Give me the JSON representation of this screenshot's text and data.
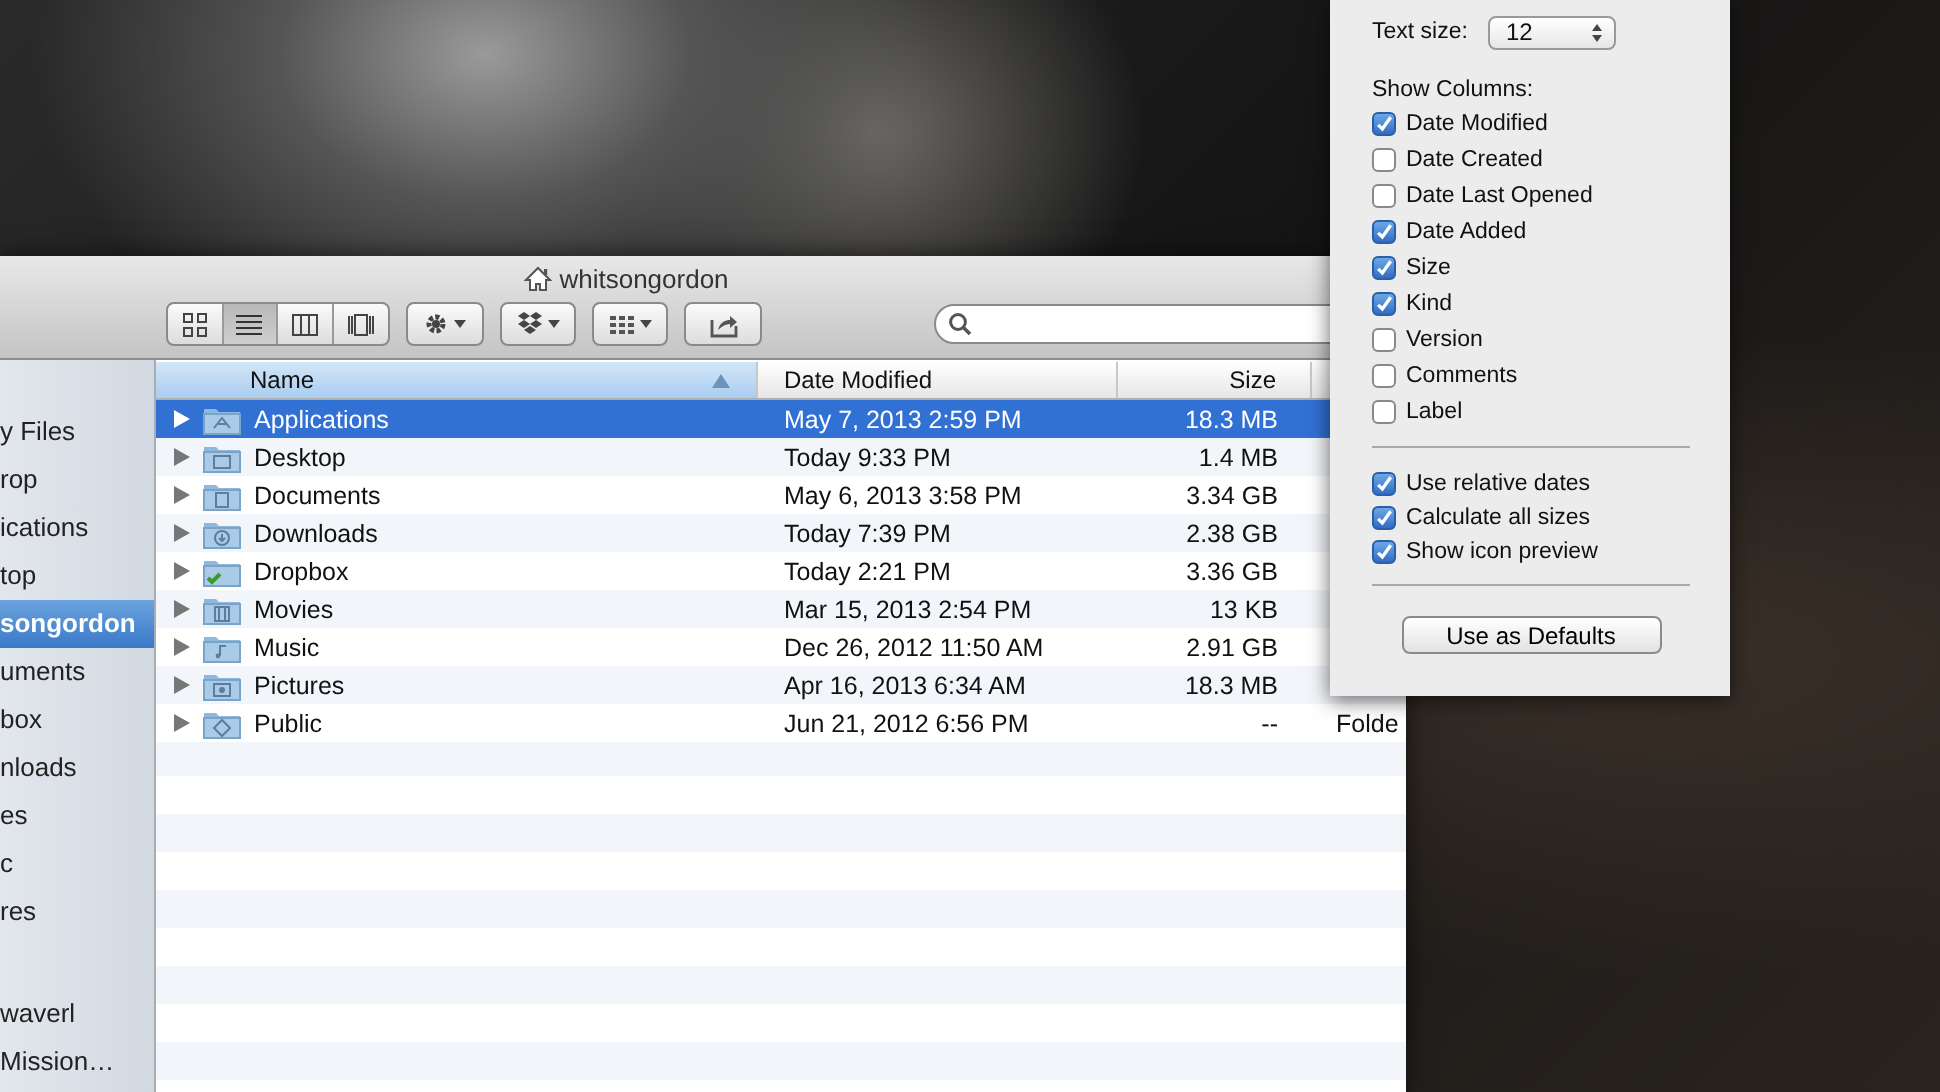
{
  "window": {
    "title": "whitsongordon"
  },
  "toolbar": {
    "view_buttons": [
      {
        "kind": "icons",
        "selected": false
      },
      {
        "kind": "list",
        "selected": true
      },
      {
        "kind": "columns",
        "selected": false
      },
      {
        "kind": "coverflow",
        "selected": false
      }
    ],
    "buttons": [
      {
        "kind": "action"
      },
      {
        "kind": "dropbox"
      },
      {
        "kind": "arrange"
      },
      {
        "kind": "share"
      }
    ]
  },
  "sidebar": {
    "sections": [
      {
        "items": [
          {
            "label": "y Files",
            "selected": false
          },
          {
            "label": "rop",
            "selected": false
          },
          {
            "label": "ications",
            "selected": false
          },
          {
            "label": "top",
            "selected": false
          },
          {
            "label": "songordon",
            "selected": true
          },
          {
            "label": "uments",
            "selected": false
          },
          {
            "label": "box",
            "selected": false
          },
          {
            "label": "nloads",
            "selected": false
          },
          {
            "label": "es",
            "selected": false
          },
          {
            "label": "c",
            "selected": false
          },
          {
            "label": "res",
            "selected": false
          }
        ]
      },
      {
        "items": [
          {
            "label": "waverl",
            "selected": false
          },
          {
            "label": "Mission…",
            "selected": false
          }
        ]
      }
    ]
  },
  "table": {
    "columns": [
      {
        "label": "Name",
        "sorted": true
      },
      {
        "label": "Date Modified",
        "sorted": false
      },
      {
        "label": "Size",
        "sorted": false
      }
    ],
    "rows": [
      {
        "kind": "applications",
        "name": "Applications",
        "date_modified": "May 7, 2013 2:59 PM",
        "size": "18.3 MB",
        "selected": true
      },
      {
        "kind": "desktop",
        "name": "Desktop",
        "date_modified": "Today 9:33 PM",
        "size": "1.4 MB",
        "selected": false
      },
      {
        "kind": "documents",
        "name": "Documents",
        "date_modified": "May 6, 2013 3:58 PM",
        "size": "3.34 GB",
        "selected": false
      },
      {
        "kind": "downloads",
        "name": "Downloads",
        "date_modified": "Today 7:39 PM",
        "size": "2.38 GB",
        "selected": false
      },
      {
        "kind": "dropbox",
        "name": "Dropbox",
        "date_modified": "Today 2:21 PM",
        "size": "3.36 GB",
        "selected": false
      },
      {
        "kind": "movies",
        "name": "Movies",
        "date_modified": "Mar 15, 2013 2:54 PM",
        "size": "13 KB",
        "selected": false
      },
      {
        "kind": "music",
        "name": "Music",
        "date_modified": "Dec 26, 2012 11:50 AM",
        "size": "2.91 GB",
        "selected": false
      },
      {
        "kind": "pictures",
        "name": "Pictures",
        "date_modified": "Apr 16, 2013 6:34 AM",
        "size": "18.3 MB",
        "selected": false
      },
      {
        "kind": "public",
        "name": "Public",
        "date_modified": "Jun 21, 2012 6:56 PM",
        "size": "--",
        "column_4": "Folde",
        "selected": false
      }
    ]
  },
  "view_options": {
    "text_size": {
      "label": "Text size:",
      "value": "12"
    },
    "show_columns": {
      "label": "Show Columns:",
      "options": [
        {
          "label": "Date Modified",
          "checked": true
        },
        {
          "label": "Date Created",
          "checked": false
        },
        {
          "label": "Date Last Opened",
          "checked": false
        },
        {
          "label": "Date Added",
          "checked": true
        },
        {
          "label": "Size",
          "checked": true
        },
        {
          "label": "Kind",
          "checked": true
        },
        {
          "label": "Version",
          "checked": false
        },
        {
          "label": "Comments",
          "checked": false
        },
        {
          "label": "Label",
          "checked": false
        }
      ]
    },
    "options": [
      {
        "label": "Use relative dates",
        "checked": true
      },
      {
        "label": "Calculate all sizes",
        "checked": true
      },
      {
        "label": "Show icon preview",
        "checked": true
      }
    ],
    "button": "Use as Defaults"
  }
}
